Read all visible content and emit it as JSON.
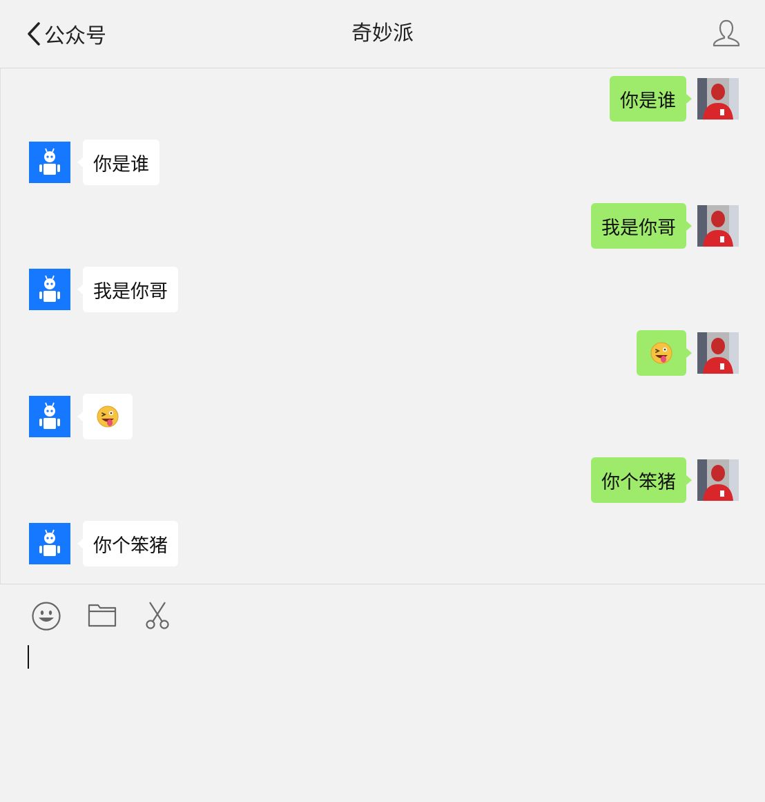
{
  "header": {
    "back_label": "公众号",
    "title": "奇妙派"
  },
  "messages": [
    {
      "side": "out",
      "text": "你是谁"
    },
    {
      "side": "in",
      "text": "你是谁"
    },
    {
      "side": "out",
      "text": "我是你哥"
    },
    {
      "side": "in",
      "text": "我是你哥"
    },
    {
      "side": "out",
      "emoji": "zany-face"
    },
    {
      "side": "in",
      "emoji": "zany-face"
    },
    {
      "side": "out",
      "text": "你个笨猪"
    },
    {
      "side": "in",
      "text": "你个笨猪"
    }
  ],
  "toolbar": {
    "icons": [
      "emoji-icon",
      "folder-icon",
      "scissors-icon"
    ]
  },
  "colors": {
    "background": "#f2f2f2",
    "outgoing_bubble": "#9eea6a",
    "incoming_bubble": "#ffffff",
    "bot_avatar": "#1677ff"
  }
}
